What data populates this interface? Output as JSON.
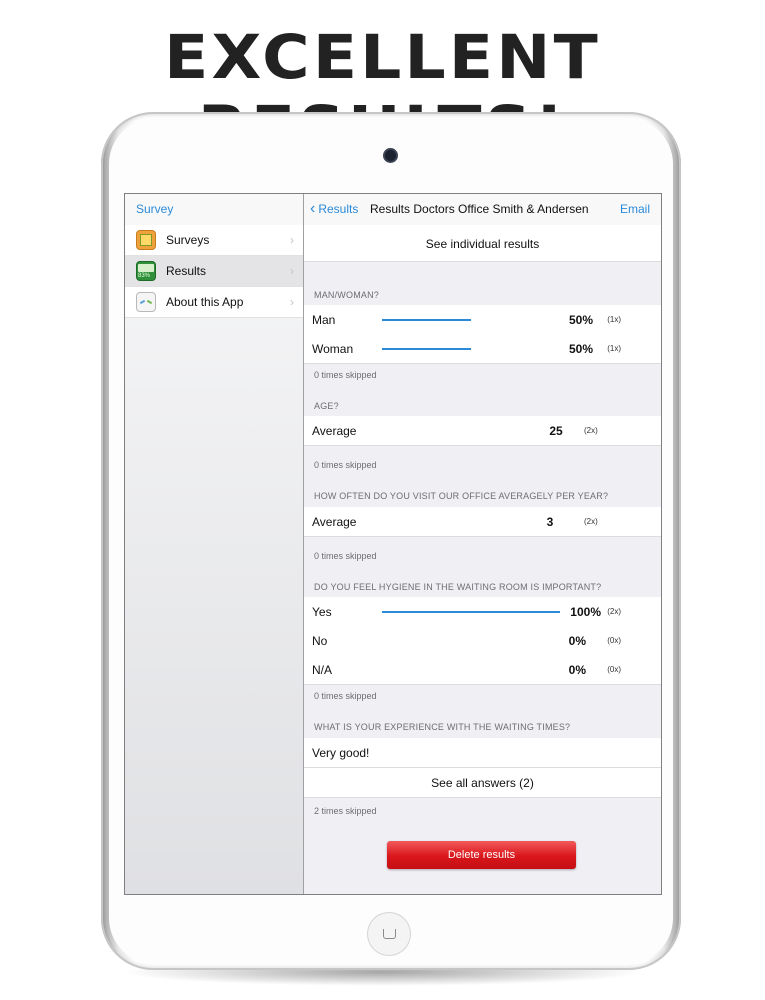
{
  "headline": "EXCELLENT RESULTS!",
  "master": {
    "title": "Survey",
    "items": [
      {
        "label": "Surveys",
        "icon": "surveys-icon"
      },
      {
        "label": "Results",
        "icon": "results-icon",
        "icon_text": "83%",
        "selected": true
      },
      {
        "label": "About this App",
        "icon": "about-icon"
      }
    ]
  },
  "detail": {
    "back_label": "Results",
    "title": "Results Doctors Office Smith & Andersen",
    "email_label": "Email",
    "individual_results": "See individual results",
    "questions": [
      {
        "header": "MAN/WOMAN?",
        "answers": [
          {
            "label": "Man",
            "fraction": 0.5,
            "percent": "50%",
            "count": "(1x)"
          },
          {
            "label": "Woman",
            "fraction": 0.5,
            "percent": "50%",
            "count": "(1x)"
          }
        ],
        "skipped": "0 times skipped"
      },
      {
        "header": "AGE?",
        "average_label": "Average",
        "average_value": "25",
        "count": "(2x)",
        "skipped": "0 times skipped"
      },
      {
        "header": "HOW OFTEN DO YOU VISIT OUR OFFICE AVERAGELY PER YEAR?",
        "average_label": "Average",
        "average_value": "3",
        "count": "(2x)",
        "skipped": "0 times skipped"
      },
      {
        "header": "DO YOU FEEL HYGIENE IN THE WAITING ROOM IS IMPORTANT?",
        "answers": [
          {
            "label": "Yes",
            "fraction": 1.0,
            "percent": "100%",
            "count": "(2x)"
          },
          {
            "label": "No",
            "fraction": 0,
            "percent": "0%",
            "count": "(0x)"
          },
          {
            "label": "N/A",
            "fraction": 0,
            "percent": "0%",
            "count": "(0x)"
          }
        ],
        "skipped": "0 times skipped"
      },
      {
        "header": "WHAT IS YOUR EXPERIENCE WITH THE WAITING TIMES?",
        "text_answer": "Very good!",
        "see_all": "See all answers (2)",
        "skipped": "2 times skipped"
      }
    ],
    "delete_label": "Delete results"
  },
  "colors": {
    "accent": "#2b8ad8",
    "delete": "#d9161b"
  }
}
